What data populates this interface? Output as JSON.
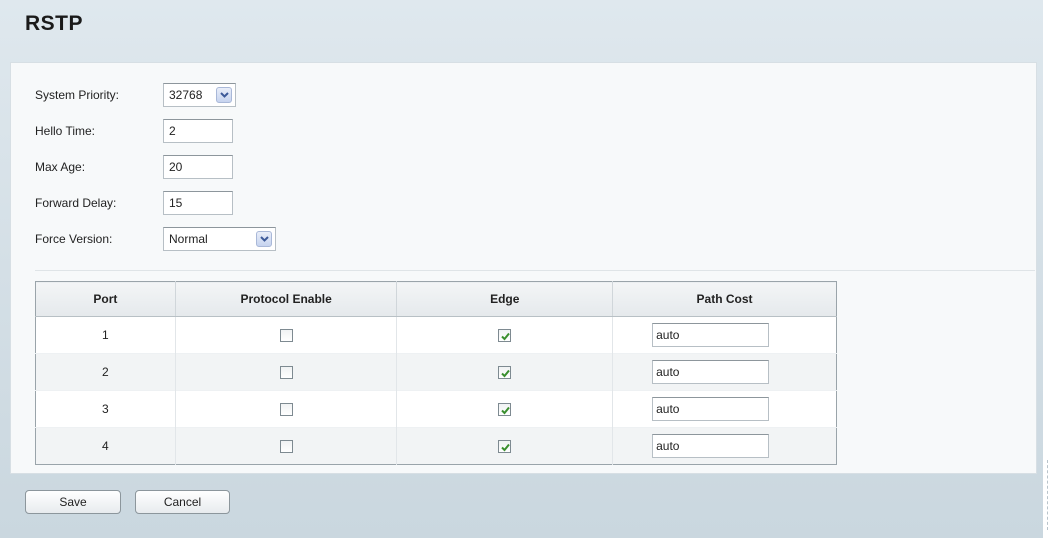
{
  "page": {
    "title": "RSTP"
  },
  "settings": {
    "system_priority": {
      "label": "System Priority:",
      "value": "32768"
    },
    "hello_time": {
      "label": "Hello Time:",
      "value": "2"
    },
    "max_age": {
      "label": "Max Age:",
      "value": "20"
    },
    "forward_delay": {
      "label": "Forward Delay:",
      "value": "15"
    },
    "force_version": {
      "label": "Force Version:",
      "value": "Normal"
    }
  },
  "port_table": {
    "headers": [
      "Port",
      "Protocol Enable",
      "Edge",
      "Path Cost"
    ],
    "rows": [
      {
        "port": "1",
        "protocol_enable": false,
        "edge": true,
        "path_cost": "auto"
      },
      {
        "port": "2",
        "protocol_enable": false,
        "edge": true,
        "path_cost": "auto"
      },
      {
        "port": "3",
        "protocol_enable": false,
        "edge": true,
        "path_cost": "auto"
      },
      {
        "port": "4",
        "protocol_enable": false,
        "edge": true,
        "path_cost": "auto"
      }
    ]
  },
  "buttons": {
    "save_label": "Save",
    "cancel_label": "Cancel"
  },
  "colors": {
    "check_mark": "#3a8f2e",
    "header_background": "#d4dfe6"
  },
  "icons": {
    "dropdown": "chevron-down-icon",
    "checkbox_checked": "checkmark-icon"
  }
}
